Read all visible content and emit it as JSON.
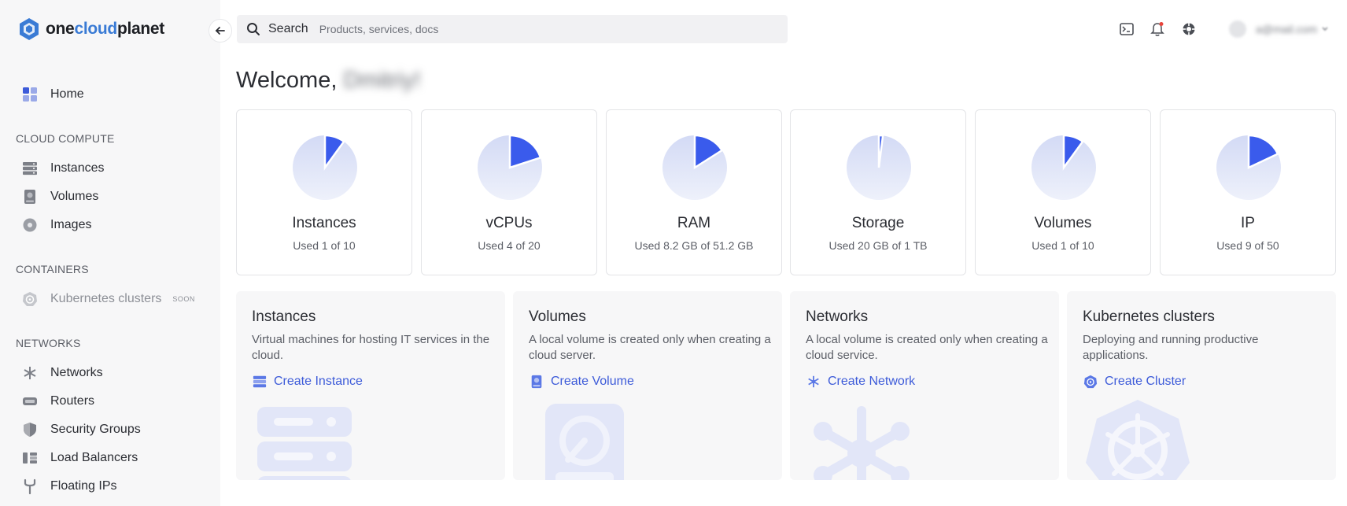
{
  "brand": {
    "name_prefix": "one",
    "name_accent": "cloud",
    "name_suffix": "planet"
  },
  "sidebar": {
    "home": "Home",
    "sections": {
      "compute": "CLOUD COMPUTE",
      "containers": "CONTAINERS",
      "networks": "NETWORKS"
    },
    "compute_items": [
      "Instances",
      "Volumes",
      "Images"
    ],
    "container_items": [
      {
        "label": "Kubernetes clusters",
        "badge": "SOON"
      }
    ],
    "network_items": [
      "Networks",
      "Routers",
      "Security Groups",
      "Load Balancers",
      "Floating IPs"
    ]
  },
  "search": {
    "label": "Search",
    "placeholder": "Products, services, docs"
  },
  "user": {
    "email": "a@mail.com"
  },
  "welcome": {
    "greeting": "Welcome,",
    "name": "Dmitriy!"
  },
  "quotas": [
    {
      "name": "Instances",
      "used_text": "Used 1 of 10",
      "fraction": 0.1
    },
    {
      "name": "vCPUs",
      "used_text": "Used 4 of 20",
      "fraction": 0.2
    },
    {
      "name": "RAM",
      "used_text": "Used 8.2 GB of 51.2 GB",
      "fraction": 0.16
    },
    {
      "name": "Storage",
      "used_text": "Used 20 GB of 1 TB",
      "fraction": 0.02
    },
    {
      "name": "Volumes",
      "used_text": "Used 1 of 10",
      "fraction": 0.1
    },
    {
      "name": "IP",
      "used_text": "Used 9 of 50",
      "fraction": 0.18
    }
  ],
  "cards": [
    {
      "title": "Instances",
      "desc": "Virtual machines for hosting IT services in the cloud.",
      "link": "Create Instance"
    },
    {
      "title": "Volumes",
      "desc": "A local volume is created only when creating a cloud server.",
      "link": "Create Volume"
    },
    {
      "title": "Networks",
      "desc": "A local volume is created only when creating a cloud service.",
      "link": "Create Network"
    },
    {
      "title": "Kubernetes clusters",
      "desc": "Deploying and running productive applications.",
      "link": "Create Cluster"
    }
  ],
  "colors": {
    "accent": "#3d5bd9",
    "pie_used": "#3a5bec",
    "pie_free": "#dfe4f7"
  }
}
